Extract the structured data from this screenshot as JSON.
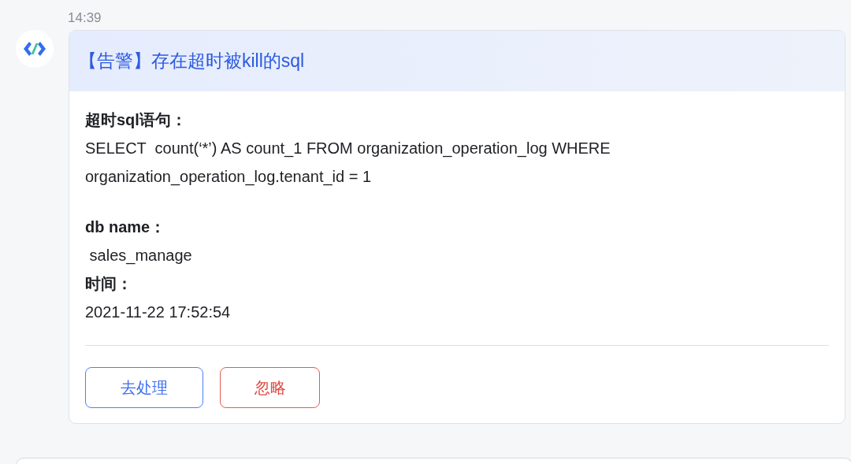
{
  "message": {
    "time": "14:39",
    "card": {
      "title": "【告警】存在超时被kill的sql",
      "fields": [
        {
          "label": "超时sql语句：",
          "value": "SELECT  count(‘*’) AS count_1 FROM organization_operation_log WHERE organization_operation_log.tenant_id = 1"
        },
        {
          "label": "db name：",
          "value": " sales_manage"
        },
        {
          "label": "时间：",
          "value": "2021-11-22 17:52:54"
        }
      ],
      "buttons": [
        {
          "label": "去处理",
          "kind": "primary"
        },
        {
          "label": "忽略",
          "kind": "danger"
        }
      ]
    }
  }
}
